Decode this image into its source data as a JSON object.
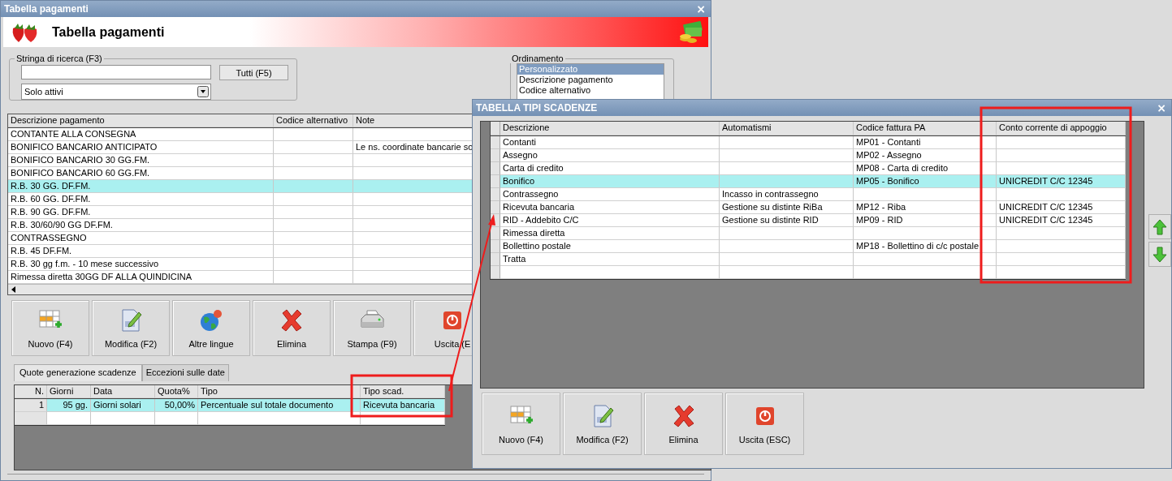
{
  "main_window": {
    "title": "Tabella pagamenti",
    "close": "×",
    "header_title": "Tabella pagamenti",
    "search": {
      "label": "Stringa di ricerca (F3)",
      "button": "Tutti (F5)",
      "filter": "Solo attivi"
    },
    "ordering": {
      "label": "Ordinamento",
      "options": [
        {
          "label": "Personalizzato",
          "selected": true
        },
        {
          "label": "Descrizione pagamento",
          "selected": false
        },
        {
          "label": "Codice alternativo",
          "selected": false
        }
      ]
    },
    "payments_table": {
      "columns": [
        "Descrizione pagamento",
        "Codice alternativo",
        "Note"
      ],
      "rows": [
        {
          "description": "CONTANTE ALLA CONSEGNA",
          "selected": false
        },
        {
          "description": "BONIFICO BANCARIO ANTICIPATO",
          "note": "Le ns. coordinate bancarie so",
          "selected": false
        },
        {
          "description": "BONIFICO BANCARIO 30 GG.FM.",
          "selected": false
        },
        {
          "description": "BONIFICO BANCARIO 60 GG.FM.",
          "selected": false
        },
        {
          "description": "R.B. 30 GG. DF.FM.",
          "selected": true
        },
        {
          "description": "R.B. 60 GG. DF.FM.",
          "selected": false
        },
        {
          "description": "R.B. 90 GG. DF.FM.",
          "selected": false
        },
        {
          "description": "R.B. 30/60/90 GG DF.FM.",
          "selected": false
        },
        {
          "description": "CONTRASSEGNO",
          "selected": false
        },
        {
          "description": "R.B. 45 DF.FM.",
          "selected": false
        },
        {
          "description": "R.B. 30 gg f.m. - 10 mese successivo",
          "selected": false
        },
        {
          "description": "Rimessa diretta 30GG DF ALLA QUINDICINA",
          "selected": false
        }
      ]
    },
    "toolbar": [
      {
        "label": "Nuovo (F4)",
        "kind": "new"
      },
      {
        "label": "Modifica (F2)",
        "kind": "edit"
      },
      {
        "label": "Altre lingue",
        "kind": "languages"
      },
      {
        "label": "Elimina",
        "kind": "delete"
      },
      {
        "label": "Stampa (F9)",
        "kind": "print"
      },
      {
        "label": "Uscita (E",
        "kind": "exit"
      }
    ],
    "tabs": [
      {
        "label": "Quote generazione scadenze",
        "selected": true
      },
      {
        "label": "Eccezioni sulle date",
        "selected": false
      }
    ],
    "schedule_table": {
      "columns": [
        "N.",
        "Giorni",
        "Data",
        "Quota%",
        "Tipo",
        "Tipo scad."
      ],
      "rows": [
        {
          "cells": [
            "1",
            "95 gg.",
            "Giorni solari",
            "50,00%",
            "Percentuale sul totale documento",
            "Ricevuta bancaria"
          ],
          "selected": true
        }
      ]
    }
  },
  "dialog": {
    "title": "TABELLA TIPI SCADENZE",
    "close": "×",
    "table": {
      "columns": [
        "Descrizione",
        "Automatismi",
        "Codice fattura PA",
        "Conto corrente di appoggio"
      ],
      "rows": [
        {
          "description": "Contanti",
          "pa_code": "MP01 - Contanti",
          "selected": false
        },
        {
          "description": "Assegno",
          "pa_code": "MP02 - Assegno",
          "selected": false
        },
        {
          "description": "Carta di credito",
          "pa_code": "MP08 - Carta di credito",
          "selected": false
        },
        {
          "description": "Bonifico",
          "pa_code": "MP05 - Bonifico",
          "account": "UNICREDIT C/C 12345",
          "selected": true
        },
        {
          "description": "Contrassegno",
          "automation": "Incasso in contrassegno",
          "selected": false
        },
        {
          "description": "Ricevuta bancaria",
          "automation": "Gestione su distinte RiBa",
          "pa_code": "MP12 - Riba",
          "account": "UNICREDIT C/C 12345",
          "selected": false
        },
        {
          "description": "RID - Addebito C/C",
          "automation": "Gestione su distinte RID",
          "pa_code": "MP09 - RID",
          "account": "UNICREDIT C/C 12345",
          "selected": false
        },
        {
          "description": "Rimessa diretta",
          "selected": false
        },
        {
          "description": "Bollettino postale",
          "pa_code": "MP18 - Bollettino di c/c postale",
          "selected": false
        },
        {
          "description": "Tratta",
          "selected": false
        }
      ]
    },
    "buttons": [
      {
        "label": "Nuovo (F4)",
        "kind": "new"
      },
      {
        "label": "Modifica (F2)",
        "kind": "edit"
      },
      {
        "label": "Elimina",
        "kind": "delete"
      },
      {
        "label": "Uscita (ESC)",
        "kind": "exit"
      }
    ]
  }
}
